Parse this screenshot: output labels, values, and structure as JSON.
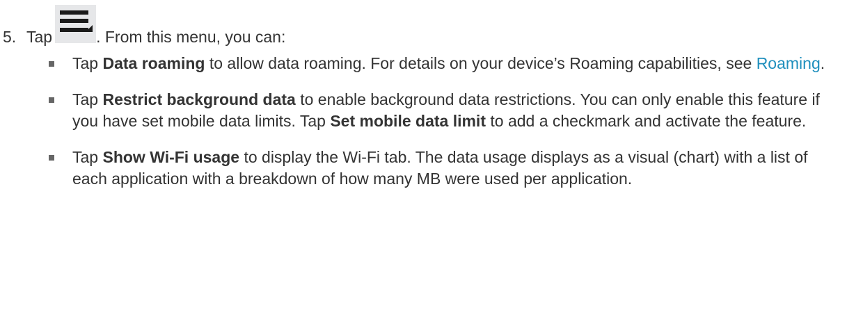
{
  "step": {
    "number": "5.",
    "prefix": "Tap",
    "suffix": ". From this menu, you can:",
    "icon": "menu-icon"
  },
  "bullets": [
    {
      "pre": "Tap ",
      "bold": "Data roaming",
      "mid": " to allow data roaming. For details on your device’s Roaming capabilities, see ",
      "link": "Roaming",
      "post": "."
    },
    {
      "pre": "Tap ",
      "bold": "Restrict background data",
      "mid": " to enable background data restrictions. You can only enable this feature if you have set mobile data limits. Tap ",
      "bold2": "Set mobile data limit",
      "post": " to add a checkmark and activate the feature."
    },
    {
      "pre": "Tap ",
      "bold": "Show Wi-Fi usage",
      "post": " to display the Wi-Fi tab. The data usage displays as a visual (chart) with a list of each application with a breakdown of how many MB were used per application."
    }
  ]
}
